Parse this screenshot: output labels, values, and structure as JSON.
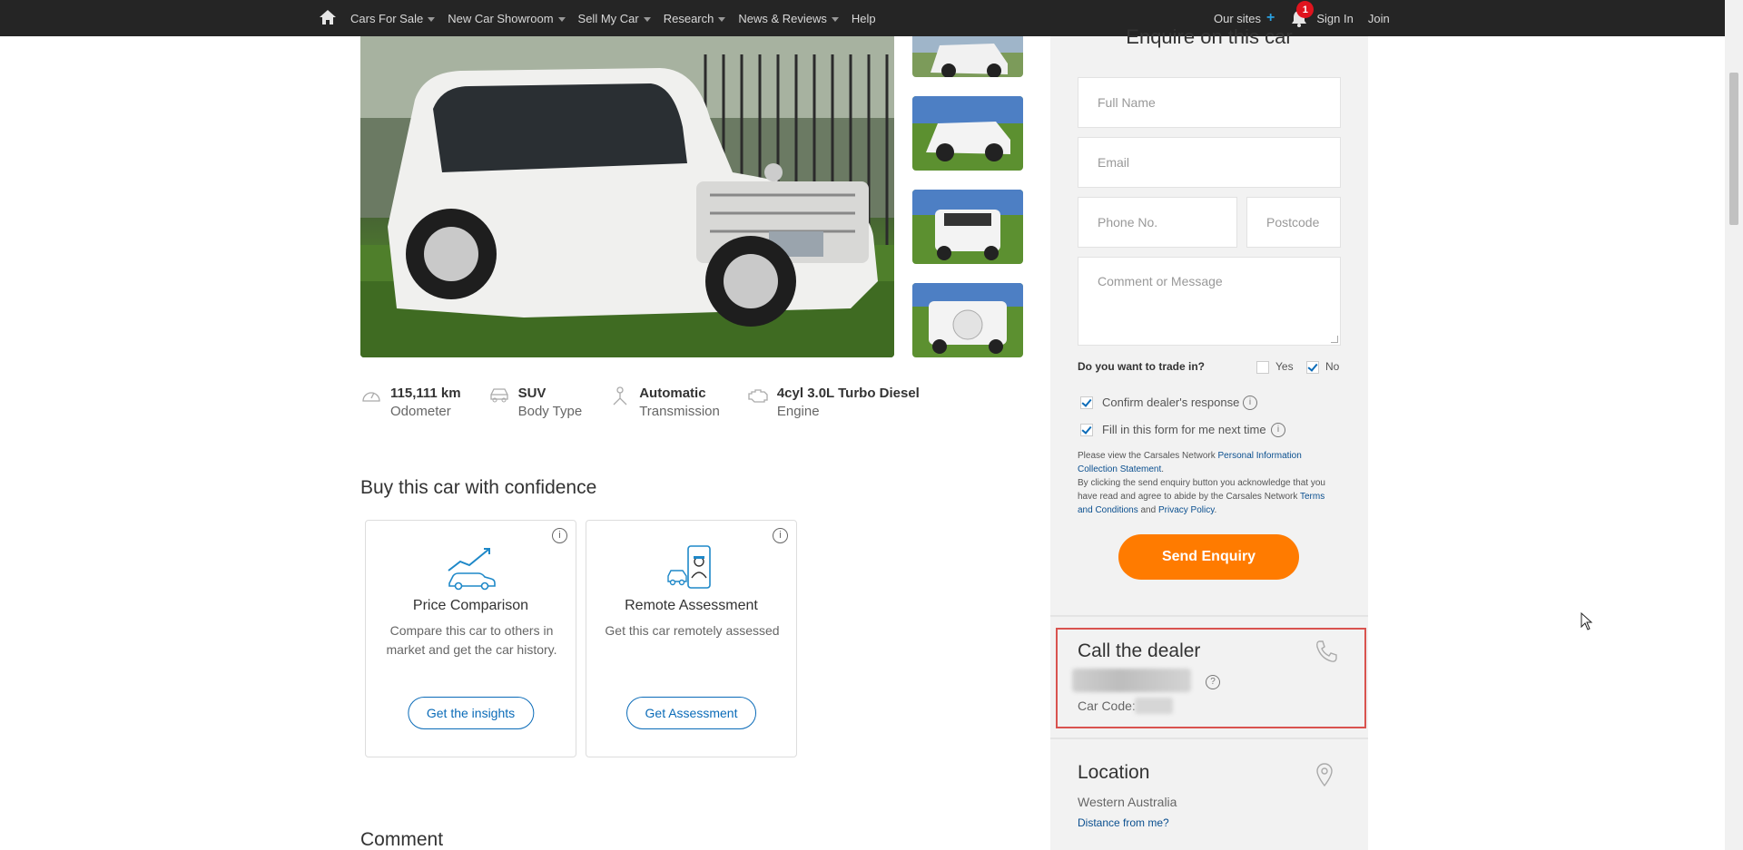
{
  "nav": {
    "items": [
      {
        "label": "Cars For Sale",
        "has_caret": true
      },
      {
        "label": "New Car Showroom",
        "has_caret": true
      },
      {
        "label": "Sell My Car",
        "has_caret": true
      },
      {
        "label": "Research",
        "has_caret": true
      },
      {
        "label": "News & Reviews",
        "has_caret": true
      },
      {
        "label": "Help",
        "has_caret": false
      }
    ],
    "our_sites": "Our sites",
    "notification_count": "1",
    "sign_in": "Sign In",
    "join": "Join"
  },
  "photo": {
    "thumbnail_count": 4
  },
  "specs": [
    {
      "value": "115,111 km",
      "label": "Odometer",
      "icon": "odometer-icon"
    },
    {
      "value": "SUV",
      "label": "Body Type",
      "icon": "car-body-icon"
    },
    {
      "value": "Automatic",
      "label": "Transmission",
      "icon": "transmission-icon"
    },
    {
      "value": "4cyl 3.0L Turbo Diesel",
      "label": "Engine",
      "icon": "engine-icon"
    }
  ],
  "confidence": {
    "title": "Buy this car with confidence",
    "cards": [
      {
        "title": "Price Comparison",
        "description": "Compare this car to others in market and get the car history.",
        "button": "Get the insights",
        "icon": "price-comparison-icon"
      },
      {
        "title": "Remote Assessment",
        "description": "Get this car remotely assessed",
        "button": "Get Assessment",
        "icon": "remote-assessment-icon"
      }
    ]
  },
  "comment_title": "Comment",
  "enquiry": {
    "title": "Enquire on this car",
    "full_name_placeholder": "Full Name",
    "email_placeholder": "Email",
    "phone_placeholder": "Phone No.",
    "postcode_placeholder": "Postcode",
    "message_placeholder": "Comment or Message",
    "trade_in_question": "Do you want to trade in?",
    "trade_in_yes": "Yes",
    "trade_in_no": "No",
    "trade_in_selected": "No",
    "confirm_response": "Confirm dealer's response",
    "confirm_response_checked": true,
    "remember_me": "Fill in this form for me next time",
    "remember_me_checked": true,
    "legal_1": "Please view the Carsales Network ",
    "legal_link_1": "Personal Information Collection Statement",
    "legal_2": ".",
    "legal_3": "By clicking the send enquiry button you acknowledge that you have read and agree to abide by the Carsales Network ",
    "legal_link_2": "Terms and Conditions",
    "legal_4": " and ",
    "legal_link_3": "Privacy Policy",
    "legal_5": ".",
    "send_button": "Send Enquiry"
  },
  "dealer": {
    "call_title": "Call the dealer",
    "car_code_label": "Car Code:"
  },
  "location": {
    "title": "Location",
    "state": "Western Australia",
    "distance_link": "Distance from me?"
  },
  "colors": {
    "nav_bg": "#252525",
    "accent_orange": "#ff7b00",
    "link_blue": "#0a6bb8",
    "highlight_red": "#d9534f",
    "badge_red": "#e0141e"
  }
}
